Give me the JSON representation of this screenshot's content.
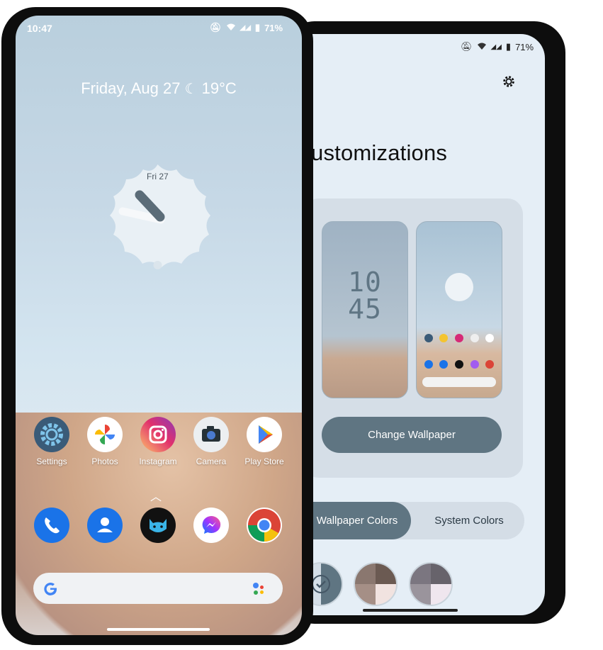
{
  "front_phone": {
    "status": {
      "time": "10:47",
      "battery": "71%"
    },
    "weather": {
      "date": "Friday, Aug 27",
      "temperature": "19°C"
    },
    "clock_widget": {
      "date": "Fri 27"
    },
    "apps": [
      {
        "label": "Settings",
        "icon": "settings-gear-icon"
      },
      {
        "label": "Photos",
        "icon": "photos-pinwheel-icon"
      },
      {
        "label": "Instagram",
        "icon": "instagram-icon"
      },
      {
        "label": "Camera",
        "icon": "camera-icon"
      },
      {
        "label": "Play Store",
        "icon": "play-store-icon"
      }
    ],
    "dock": [
      {
        "icon": "phone-icon"
      },
      {
        "icon": "contacts-icon"
      },
      {
        "icon": "cat-app-icon"
      },
      {
        "icon": "messenger-icon"
      },
      {
        "icon": "chrome-icon"
      }
    ],
    "search": {
      "logo": "google-g-icon",
      "assistant": "assistant-dots-icon"
    }
  },
  "back_phone": {
    "status": {
      "battery": "71%"
    },
    "title": "ustomizations",
    "lock_preview_clock": {
      "hour": "10",
      "minute": "45"
    },
    "change_wallpaper_label": "Change Wallpaper",
    "tabs": {
      "wallpaper_colors": "Wallpaper Colors",
      "system_colors": "System Colors"
    }
  },
  "colors": {
    "accent": "#5f7582",
    "card": "#d5dee7",
    "screen_bg": "#e5eef6"
  }
}
